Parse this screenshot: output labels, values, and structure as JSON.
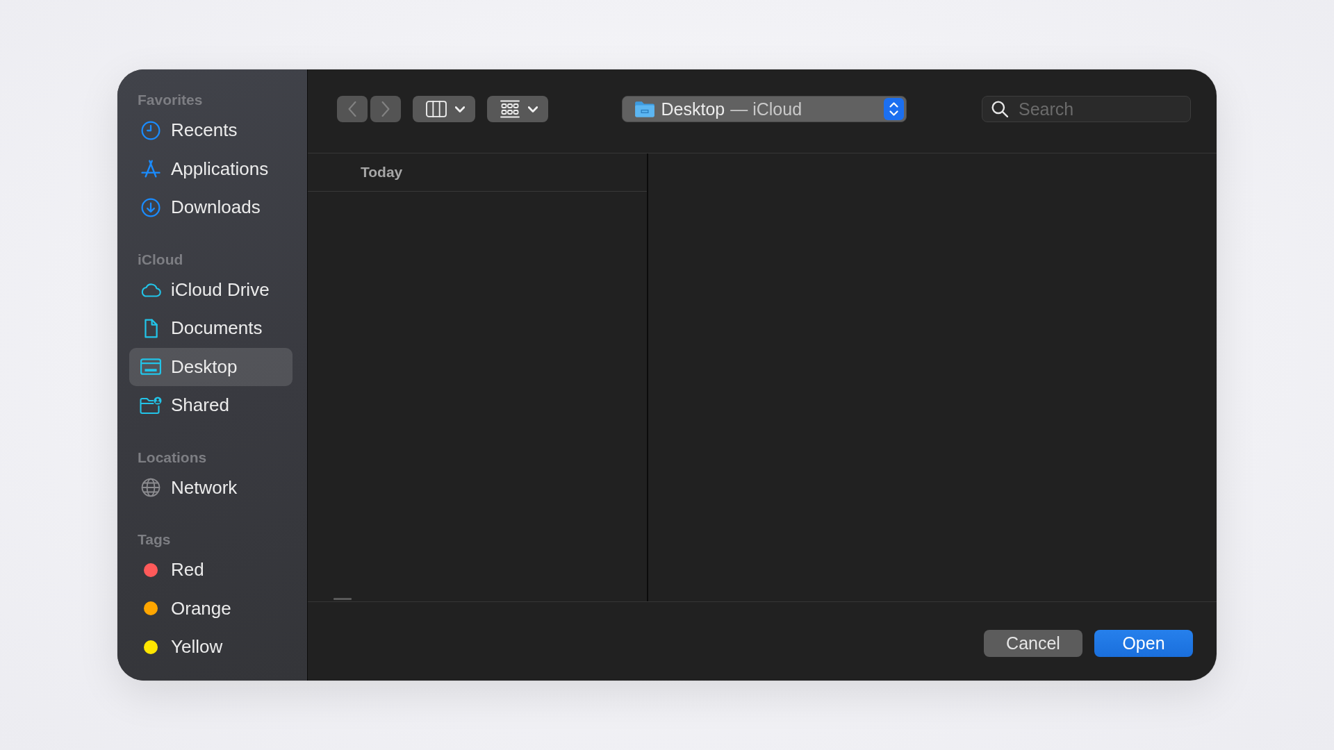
{
  "sidebar": {
    "sections": [
      {
        "heading": "Favorites",
        "items": [
          {
            "kind": "place",
            "label": "Recents",
            "selected": false
          },
          {
            "kind": "place",
            "label": "Applications",
            "selected": false
          },
          {
            "kind": "place",
            "label": "Downloads",
            "selected": false
          }
        ]
      },
      {
        "heading": "iCloud",
        "items": [
          {
            "kind": "place",
            "label": "iCloud Drive",
            "selected": false
          },
          {
            "kind": "place",
            "label": "Documents",
            "selected": false
          },
          {
            "kind": "place",
            "label": "Desktop",
            "selected": true
          },
          {
            "kind": "place",
            "label": "Shared",
            "selected": false
          }
        ]
      },
      {
        "heading": "Locations",
        "items": [
          {
            "kind": "place",
            "label": "Network",
            "selected": false
          }
        ]
      },
      {
        "heading": "Tags",
        "items": [
          {
            "kind": "tag",
            "label": "Red",
            "color": "#ff5a5a",
            "selected": false
          },
          {
            "kind": "tag",
            "label": "Orange",
            "color": "#ffa600",
            "selected": false
          },
          {
            "kind": "tag",
            "label": "Yellow",
            "color": "#ffe600",
            "selected": false
          }
        ]
      }
    ]
  },
  "toolbar": {
    "nav_buttons": [
      {
        "kind": "back",
        "disabled": true
      },
      {
        "kind": "forward",
        "disabled": true
      }
    ],
    "location_popup": {
      "folder": "Desktop",
      "account": "— iCloud"
    },
    "search": {
      "placeholder": "Search"
    }
  },
  "browser": {
    "group_header": "Today"
  },
  "buttons": [
    {
      "label": "Cancel",
      "kind": "secondary"
    },
    {
      "label": "Open",
      "kind": "primary"
    }
  ]
}
